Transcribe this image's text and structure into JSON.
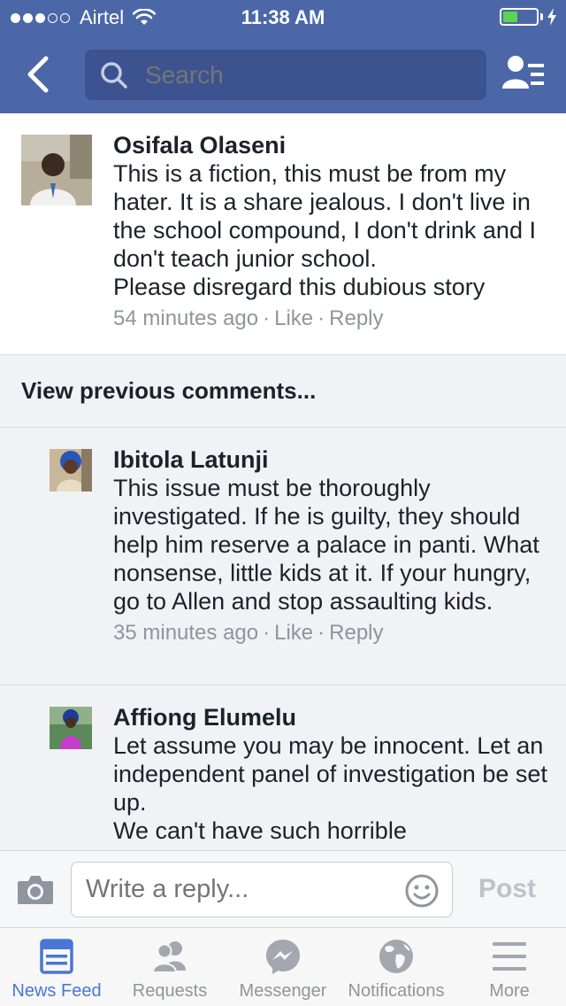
{
  "status_bar": {
    "carrier": "Airtel",
    "time": "11:38 AM",
    "signal_bars": 3,
    "signal_total": 5,
    "battery_level": 0.45,
    "battery_color": "#5ed34f"
  },
  "nav": {
    "search_placeholder": "Search",
    "back_icon": "chevron-left-icon",
    "friends_icon": "friend-requests-icon",
    "color": "#4b67a8"
  },
  "top_comment": {
    "author": "Osifala Olaseni",
    "text": "This is a fiction, this must be from my hater. It is a share jealous. I don't live in the school compound, I don't drink and I don't teach junior school.\nPlease disregard this dubious story",
    "time": "54 minutes ago",
    "like": "Like",
    "reply": "Reply",
    "separator": "·"
  },
  "view_previous": "View previous comments...",
  "replies": [
    {
      "author": "Ibitola Latunji",
      "text": "This issue must be thoroughly investigated. If he is guilty,  they should help him reserve a palace in panti. What nonsense, little kids at it. If your hungry,  go to Allen and stop assaulting kids.",
      "time": "35 minutes ago",
      "like": "Like",
      "reply": "Reply",
      "separator": "·"
    },
    {
      "author": "Affiong Elumelu",
      "text": "Let assume you may be innocent. Let an independent panel of investigation be set up.\nWe can't have such horrible"
    }
  ],
  "composer": {
    "placeholder": "Write a reply...",
    "post_label": "Post",
    "camera_icon": "camera-icon",
    "emoji_icon": "smiley-icon"
  },
  "tabs": [
    {
      "label": "News Feed",
      "icon": "news-feed-icon",
      "active": true
    },
    {
      "label": "Requests",
      "icon": "requests-icon",
      "active": false
    },
    {
      "label": "Messenger",
      "icon": "messenger-icon",
      "active": false
    },
    {
      "label": "Notifications",
      "icon": "globe-icon",
      "active": false
    },
    {
      "label": "More",
      "icon": "menu-icon",
      "active": false
    }
  ],
  "colors": {
    "fb_blue": "#4b67a8",
    "tab_active": "#4a76d4",
    "meta_gray": "#90949c"
  }
}
